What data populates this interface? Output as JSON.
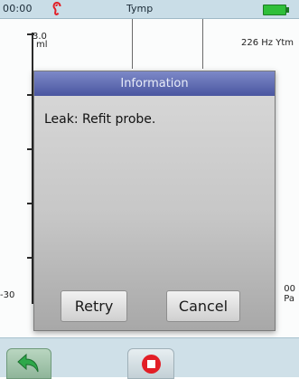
{
  "status": {
    "time": "00:00",
    "mode": "Tymp",
    "battery_color": "#2fbf3a",
    "ear_color": "#e21e26"
  },
  "plot": {
    "y_max": "3.0",
    "y_unit": "ml",
    "frequency": "226 Hz Ytm",
    "x_min": "-30",
    "x_max": "00",
    "x_unit": "Pa"
  },
  "dialog": {
    "title": "Information",
    "message": "Leak: Refit probe.",
    "retry_label": "Retry",
    "cancel_label": "Cancel"
  },
  "nav": {
    "back_icon": "back-arrow-icon",
    "stop_icon": "stop-icon"
  }
}
